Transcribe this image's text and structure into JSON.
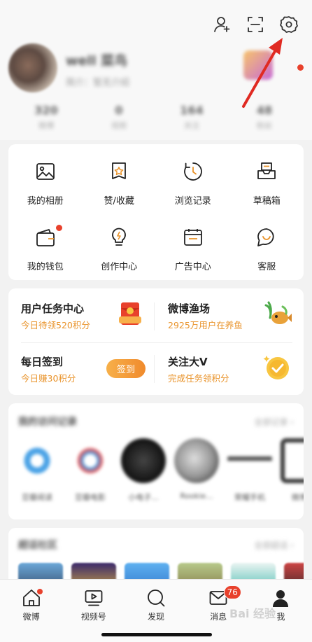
{
  "header": {
    "icons": [
      "person-plus-icon",
      "scan-icon",
      "gear-icon"
    ],
    "nickname": "well 菜鸟",
    "bio": "简介：暂无介绍",
    "stats": [
      {
        "num": "320",
        "label": "微博"
      },
      {
        "num": "0",
        "label": "视频"
      },
      {
        "num": "164",
        "label": "关注"
      },
      {
        "num": "48",
        "label": "粉丝"
      }
    ]
  },
  "grid": {
    "items": [
      {
        "label": "我的相册",
        "icon": "photo-album-icon"
      },
      {
        "label": "赞/收藏",
        "icon": "like-collect-icon"
      },
      {
        "label": "浏览记录",
        "icon": "history-clock-icon"
      },
      {
        "label": "草稿箱",
        "icon": "drafts-icon"
      },
      {
        "label": "我的钱包",
        "icon": "wallet-icon"
      },
      {
        "label": "创作中心",
        "icon": "creator-bulb-icon"
      },
      {
        "label": "广告中心",
        "icon": "ad-center-icon"
      },
      {
        "label": "客服",
        "icon": "customer-service-icon"
      }
    ]
  },
  "tasks": {
    "task_center": {
      "title": "用户任务中心",
      "sub": "今日待领520积分"
    },
    "fishing": {
      "title": "微博渔场",
      "sub": "2925万用户在养鱼"
    },
    "checkin": {
      "title": "每日签到",
      "sub": "今日赚30积分",
      "button": "签到"
    },
    "follow_v": {
      "title": "关注大V",
      "sub": "完成任务领积分"
    }
  },
  "records": {
    "title": "我的访问记录",
    "more": "全部记录 ›",
    "items": [
      {
        "name": "豆瓣阅读"
      },
      {
        "name": "豆瓣电影"
      },
      {
        "name": "小电子..."
      },
      {
        "name": "Rookie..."
      },
      {
        "name": "荣耀手机"
      },
      {
        "name": "微博..."
      }
    ]
  },
  "recommend": {
    "title": "超话社区",
    "more": "全部超话 ›"
  },
  "tabbar": {
    "tabs": [
      {
        "label": "微博",
        "icon": "home-icon"
      },
      {
        "label": "视频号",
        "icon": "video-icon"
      },
      {
        "label": "发现",
        "icon": "search-icon"
      },
      {
        "label": "消息",
        "icon": "mail-icon",
        "badge": "76"
      },
      {
        "label": "我",
        "icon": "profile-icon"
      }
    ]
  },
  "watermark": "Bai 经验",
  "colors": {
    "accent_orange": "#e9932a",
    "badge_red": "#e8412c"
  }
}
